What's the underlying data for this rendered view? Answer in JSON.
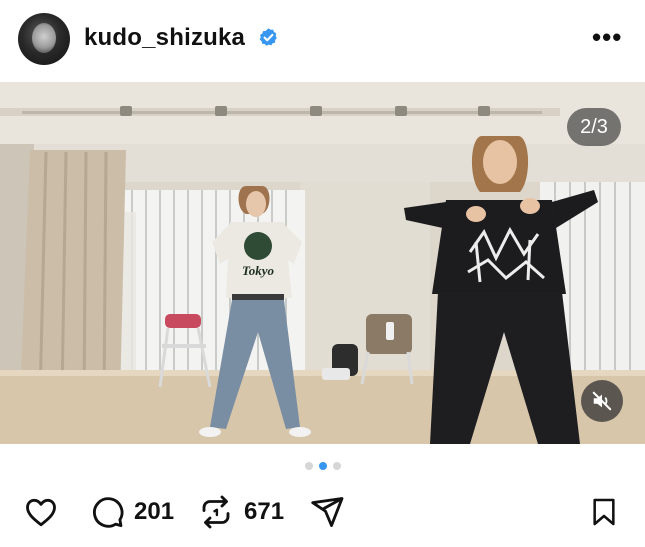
{
  "post": {
    "username": "kudo_shizuka",
    "verified": true,
    "more_icon": "more-horizontal-icon"
  },
  "media": {
    "counter": "2/3",
    "mute_icon": "speaker-muted-icon",
    "sweater_text": "Tokyo",
    "carousel_dots": 3,
    "active_dot": 2
  },
  "actions": {
    "comments": "201",
    "reposts": "671",
    "icons": [
      "heart-icon",
      "comment-icon",
      "repost-icon",
      "share-icon",
      "bookmark-icon"
    ]
  },
  "colors": {
    "accent": "#3797f0",
    "text": "#111111"
  }
}
